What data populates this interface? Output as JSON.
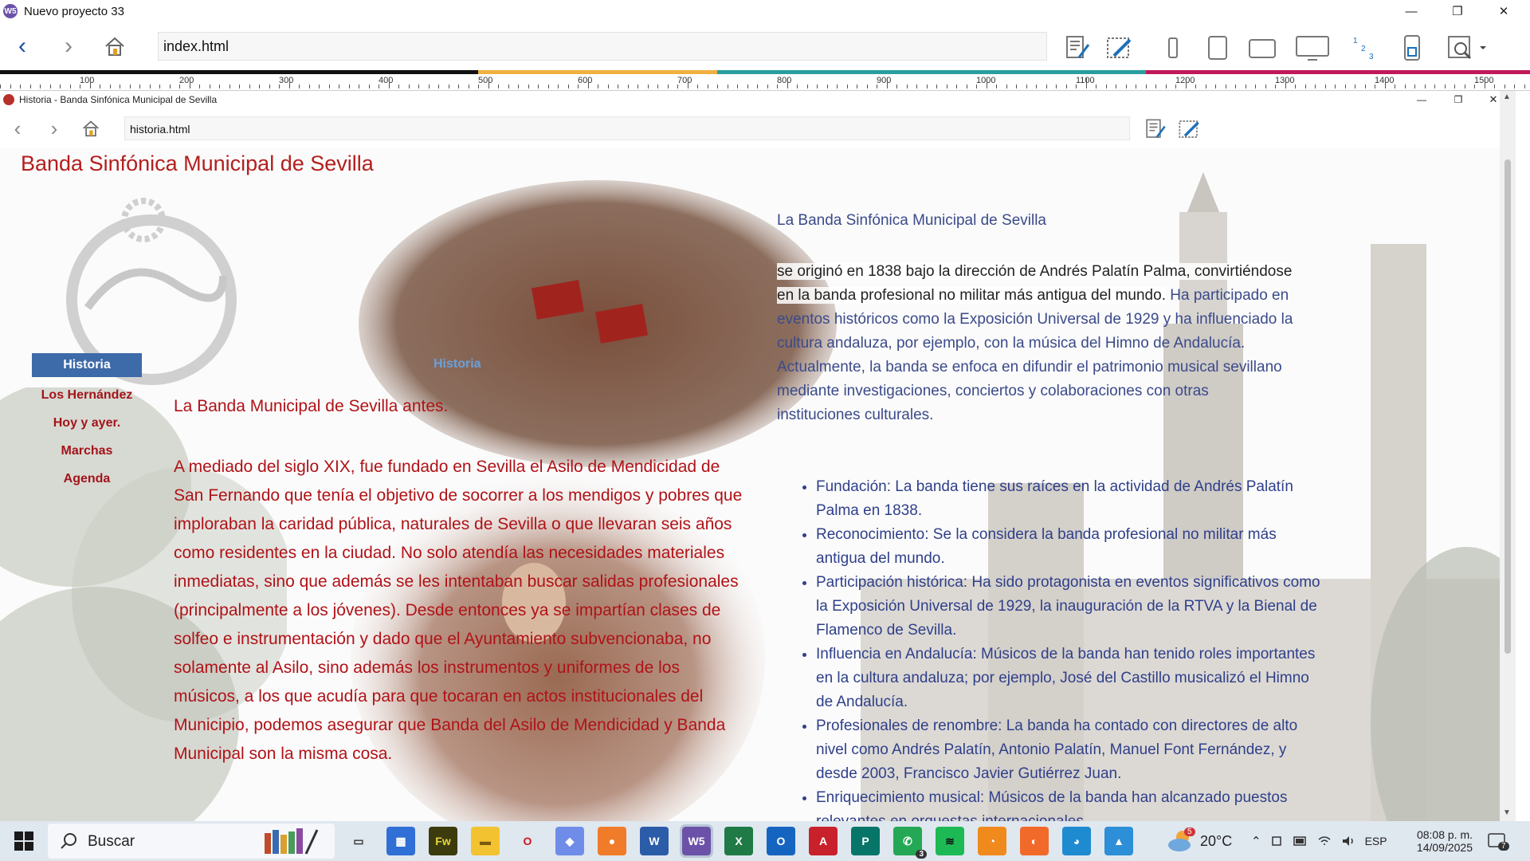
{
  "window": {
    "title": "Nuevo proyecto 33",
    "app_icon": "W5",
    "url": "index.html",
    "ruler_labels": [
      "100",
      "200",
      "300",
      "400",
      "500",
      "600",
      "700",
      "800",
      "900",
      "1000",
      "1100",
      "1200",
      "1300",
      "1400",
      "1500"
    ]
  },
  "inner_window": {
    "title": "Historia - Banda Sinfónica Municipal de Sevilla",
    "url": "historia.html"
  },
  "site": {
    "title": "Banda Sinfónica Municipal de Sevilla",
    "menu": [
      "Historia",
      "Los Hernández",
      "Hoy y ayer.",
      "Marchas",
      "Agenda"
    ],
    "history_link": "Historia",
    "left_heading": "La Banda Municipal de Sevilla antes.",
    "left_text": "A mediado del siglo XIX, fue fundado en Sevilla el Asilo de Mendicidad de San Fernando que tenía el objetivo de socorrer a los mendigos y pobres que imploraban la caridad pública, naturales de Sevilla o que llevaran seis años como residentes en la ciudad. No solo atendía las necesidades materiales inmediatas, sino que además se les intentaban buscar salidas profesionales (principalmente a los jóvenes). Desde entonces ya se impartían clases de solfeo e instrumentación y dado que el Ayuntamiento subvencionaba, no solamente al Asilo, sino además los instrumentos y uniformes de los músicos, a los que acudía para que tocaran en actos institucionales del Municipio, podemos asegurar que Banda del Asilo de Mendicidad y Banda Municipal son la misma cosa.",
    "right_heading": "La Banda Sinfónica Municipal de Sevilla",
    "right_para_dark": "se  originó en 1838 bajo la dirección de Andrés Palatín Palma,  convirtiéndose en la banda profesional no militar más antigua del mundo.",
    "right_para_rest": "  Ha participado en eventos históricos como la Exposición Universal de  1929 y ha influenciado la cultura andaluza, por ejemplo, con la música  del Himno de Andalucía. Actualmente, la banda se enfoca en difundir el  patrimonio musical sevillano mediante investigaciones, conciertos y  colaboraciones con otras instituciones culturales.",
    "bullets": [
      "Fundación: La banda tiene sus raíces en la actividad de Andrés Palatín Palma en 1838.",
      "Reconocimiento: Se la considera la banda profesional no militar más antigua del mundo.",
      "Participación histórica:  Ha sido protagonista en eventos significativos como la Exposición  Universal de 1929, la inauguración de la RTVA y la Bienal de Flamenco de  Sevilla.",
      "Influencia en Andalucía:  Músicos de la banda han tenido roles importantes en la cultura  andaluza; por ejemplo, José del Castillo musicalizó el Himno de  Andalucía.",
      "Profesionales de renombre:  La banda ha contado con directores de alto nivel como Andrés Palatín,  Antonio Palatín, Manuel Font Fernández, y desde 2003, Francisco Javier  Gutiérrez Juan.",
      "Enriquecimiento musical: Músicos de la banda han alcanzado puestos relevantes en orquestas internacionales."
    ]
  },
  "taskbar": {
    "search": "Buscar",
    "weather": "20°C",
    "language": "ESP",
    "time": "08:08 p. m.",
    "date": "14/09/2025",
    "whatsapp_badge": "3",
    "weather_badge": "5",
    "notif_badge": "7",
    "apps": [
      "task-view",
      "store",
      "fireworks",
      "explorer",
      "opera",
      "copilot",
      "firefox",
      "word",
      "w5",
      "excel",
      "outlook",
      "acrobat",
      "publisher",
      "whatsapp",
      "spotify",
      "clock",
      "app-orange",
      "edge",
      "paint"
    ],
    "app_labels": {
      "fireworks": "Fw",
      "word": "W",
      "w5": "W5",
      "excel": "X",
      "outlook": "O",
      "acrobat": "A",
      "publisher": "P"
    }
  },
  "colors": {
    "site_red": "#b01217",
    "site_blue": "#3b4a8a",
    "menu_active": "#3d6aa9",
    "nav_blue": "#1b4f9a"
  }
}
